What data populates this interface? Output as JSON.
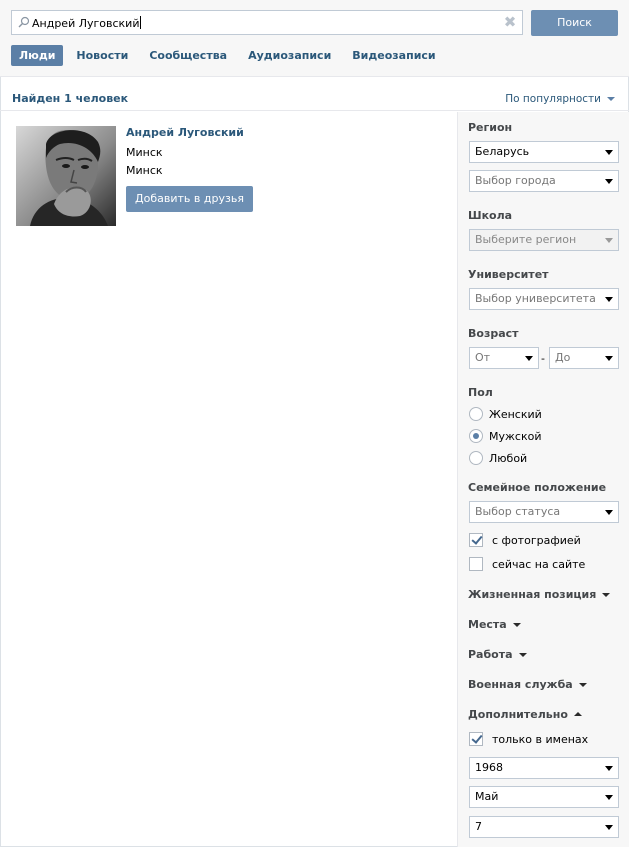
{
  "search": {
    "query": "Андрей Луговский",
    "button_label": "Поиск"
  },
  "tabs": [
    {
      "label": "Люди",
      "active": true
    },
    {
      "label": "Новости",
      "active": false
    },
    {
      "label": "Сообщества",
      "active": false
    },
    {
      "label": "Аудиозаписи",
      "active": false
    },
    {
      "label": "Видеозаписи",
      "active": false
    }
  ],
  "results": {
    "count_text": "Найден 1 человек",
    "sort_label": "По популярности"
  },
  "person": {
    "name": "Андрей Луговский",
    "city_line_1": "Минск",
    "city_line_2": "Минск",
    "add_friend_label": "Добавить в друзья"
  },
  "filters": {
    "region": {
      "heading": "Регион",
      "country": "Беларусь",
      "city_placeholder": "Выбор города"
    },
    "school": {
      "heading": "Школа",
      "placeholder": "Выберите регион"
    },
    "university": {
      "heading": "Университет",
      "placeholder": "Выбор университета"
    },
    "age": {
      "heading": "Возраст",
      "from": "От",
      "separator": "-",
      "to": "До"
    },
    "gender": {
      "heading": "Пол",
      "options": [
        {
          "label": "Женский",
          "selected": false
        },
        {
          "label": "Мужской",
          "selected": true
        },
        {
          "label": "Любой",
          "selected": false
        }
      ]
    },
    "marital": {
      "heading": "Семейное положение",
      "placeholder": "Выбор статуса"
    },
    "with_photo": {
      "label": "с фотографией",
      "checked": true
    },
    "online_now": {
      "label": "сейчас на сайте",
      "checked": false
    },
    "collapsed_sections": [
      "Жизненная позиция",
      "Места",
      "Работа",
      "Военная служба"
    ],
    "extra": {
      "heading": "Дополнительно",
      "names_only": {
        "label": "только в именах",
        "checked": true
      },
      "birth_year": "1968",
      "birth_month": "Май",
      "birth_day": "7"
    }
  },
  "colors": {
    "accent": "#5b7fa6",
    "button": "#6d8fb3",
    "link": "#2b587a",
    "panel_bg": "#f7f7f7"
  }
}
